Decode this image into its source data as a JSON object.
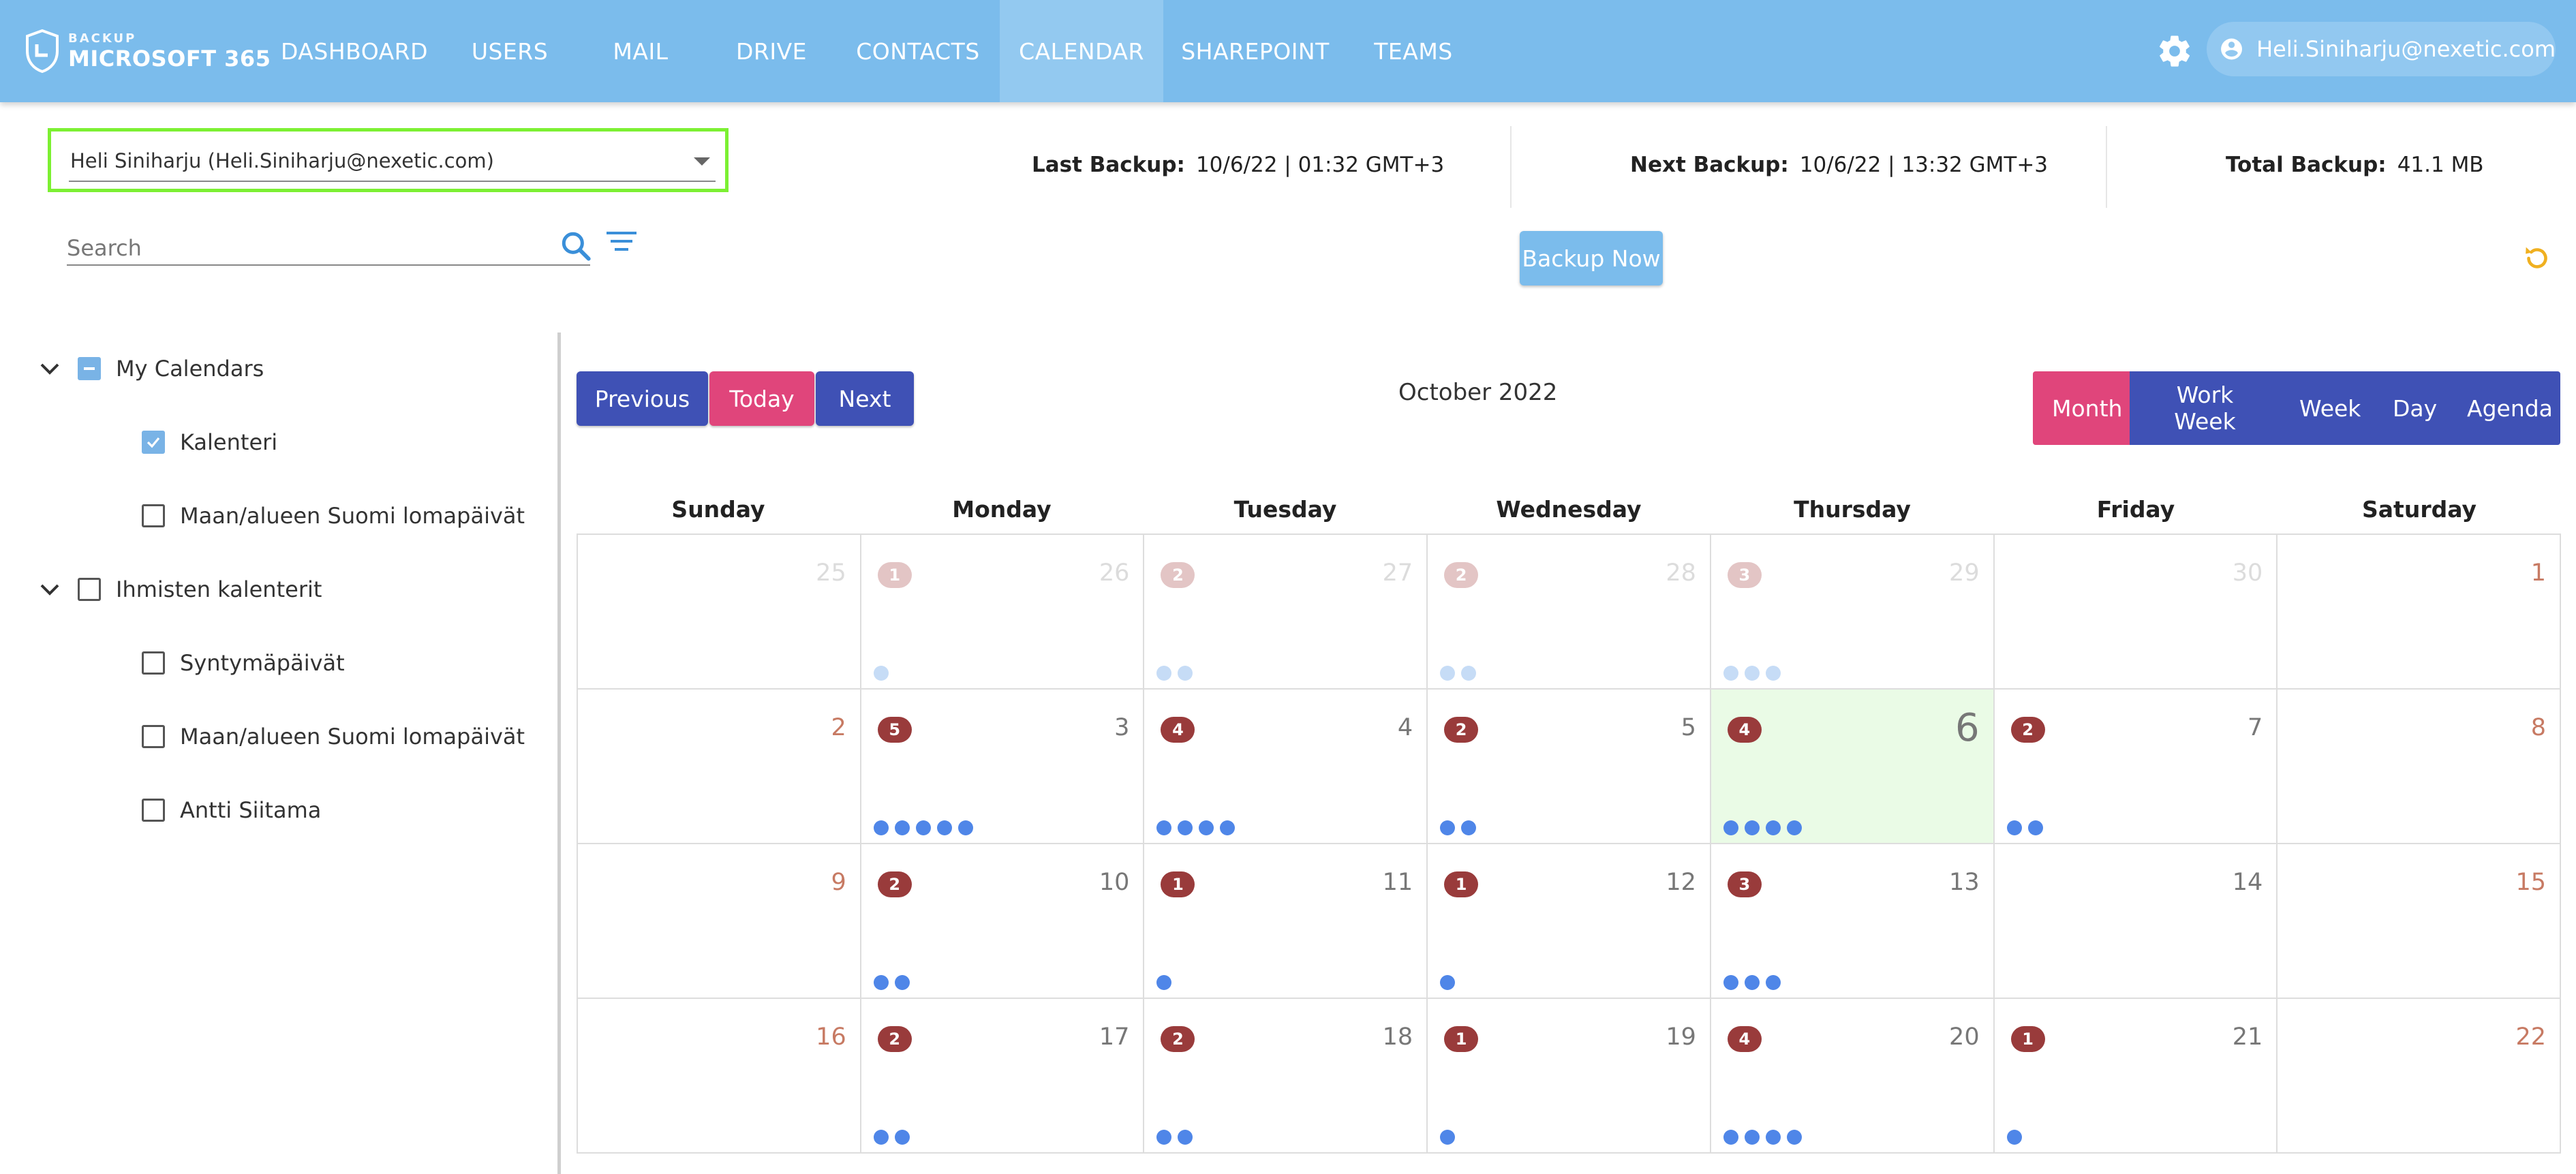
{
  "brand": {
    "small": "BACKUP",
    "big": "MICROSOFT 365"
  },
  "nav": [
    "DASHBOARD",
    "USERS",
    "MAIL",
    "DRIVE",
    "CONTACTS",
    "CALENDAR",
    "SHAREPOINT",
    "TEAMS"
  ],
  "nav_active": "CALENDAR",
  "user": {
    "email": "Heli.Siniharju@nexetic.com"
  },
  "user_select": {
    "value": "Heli Siniharju  (Heli.Siniharju@nexetic.com)"
  },
  "stats": {
    "last_label": "Last Backup:",
    "last_value": "10/6/22 | 01:32 GMT+3",
    "next_label": "Next Backup:",
    "next_value": "10/6/22 | 13:32 GMT+3",
    "total_label": "Total Backup:",
    "total_value": "41.1 MB"
  },
  "search": {
    "placeholder": "Search",
    "value": ""
  },
  "backup_now": "Backup Now",
  "sidebar": {
    "groups": [
      {
        "label": "My Calendars",
        "state": "indeterminate",
        "items": [
          {
            "label": "Kalenteri",
            "checked": true
          },
          {
            "label": "Maan/alueen Suomi lomapäivät",
            "checked": false
          }
        ]
      },
      {
        "label": "Ihmisten kalenterit",
        "state": "unchecked",
        "items": [
          {
            "label": "Syntymäpäivät",
            "checked": false
          },
          {
            "label": "Maan/alueen Suomi lomapäivät",
            "checked": false
          },
          {
            "label": "Antti Siitama",
            "checked": false
          }
        ]
      }
    ]
  },
  "toolbar": {
    "previous": "Previous",
    "today": "Today",
    "next": "Next"
  },
  "calendar": {
    "title": "October 2022",
    "views": [
      "Month",
      "Work Week",
      "Week",
      "Day",
      "Agenda"
    ],
    "active_view": "Month",
    "weekdays": [
      "Sunday",
      "Monday",
      "Tuesday",
      "Wednesday",
      "Thursday",
      "Friday",
      "Saturday"
    ],
    "weeks": [
      [
        {
          "day": "25",
          "outside": true,
          "count": 0
        },
        {
          "day": "26",
          "outside": true,
          "count": 1
        },
        {
          "day": "27",
          "outside": true,
          "count": 2
        },
        {
          "day": "28",
          "outside": true,
          "count": 2
        },
        {
          "day": "29",
          "outside": true,
          "count": 3
        },
        {
          "day": "30",
          "outside": true,
          "count": 0
        },
        {
          "day": "1",
          "outside": false,
          "count": 0
        }
      ],
      [
        {
          "day": "2",
          "outside": false,
          "count": 0
        },
        {
          "day": "3",
          "outside": false,
          "count": 5
        },
        {
          "day": "4",
          "outside": false,
          "count": 4
        },
        {
          "day": "5",
          "outside": false,
          "count": 2
        },
        {
          "day": "6",
          "outside": false,
          "count": 4,
          "today": true
        },
        {
          "day": "7",
          "outside": false,
          "count": 2
        },
        {
          "day": "8",
          "outside": false,
          "count": 0
        }
      ],
      [
        {
          "day": "9",
          "outside": false,
          "count": 0
        },
        {
          "day": "10",
          "outside": false,
          "count": 2
        },
        {
          "day": "11",
          "outside": false,
          "count": 1
        },
        {
          "day": "12",
          "outside": false,
          "count": 1
        },
        {
          "day": "13",
          "outside": false,
          "count": 3
        },
        {
          "day": "14",
          "outside": false,
          "count": 0
        },
        {
          "day": "15",
          "outside": false,
          "count": 0
        }
      ],
      [
        {
          "day": "16",
          "outside": false,
          "count": 0
        },
        {
          "day": "17",
          "outside": false,
          "count": 2
        },
        {
          "day": "18",
          "outside": false,
          "count": 2
        },
        {
          "day": "19",
          "outside": false,
          "count": 1
        },
        {
          "day": "20",
          "outside": false,
          "count": 4
        },
        {
          "day": "21",
          "outside": false,
          "count": 1
        },
        {
          "day": "22",
          "outside": false,
          "count": 0
        }
      ]
    ]
  },
  "colors": {
    "topbar": "#7bbcec",
    "indigo": "#3f51b5",
    "pink": "#e0457b",
    "badge": "#993b3b",
    "dot": "#4f86e8",
    "today_bg": "#eafbe6",
    "select_outline": "#7cf032",
    "refresh": "#f0b020"
  }
}
